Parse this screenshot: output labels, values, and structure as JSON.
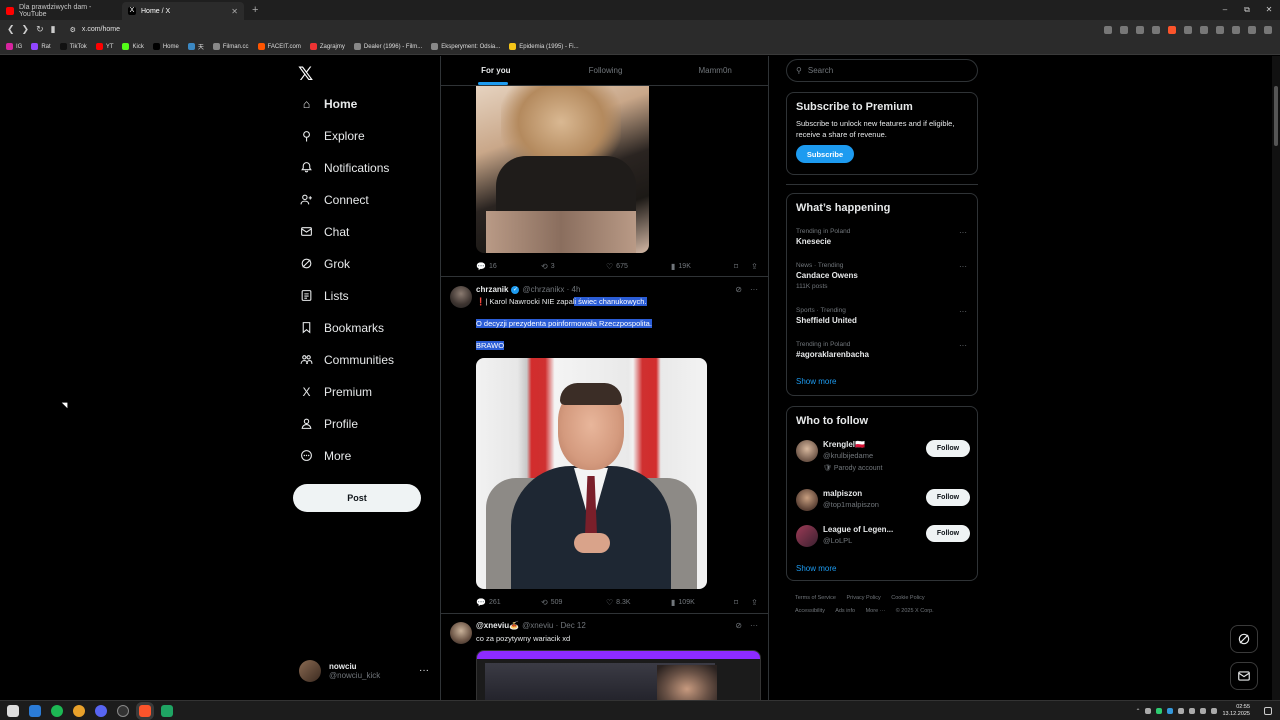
{
  "browser": {
    "tabs": [
      {
        "title": "Dla prawdziwych dam - YouTube",
        "favicon": "youtube-icon",
        "active": false
      },
      {
        "title": "Home / X",
        "favicon": "x-logo-icon",
        "active": true
      }
    ],
    "new_tab": "+",
    "window_controls": [
      "–",
      "⧉",
      "✕"
    ],
    "url": "x.com/home",
    "bookmarks": [
      "IG",
      "Rat",
      "TikTok",
      "YT",
      "Kick",
      "Home",
      "天",
      "Filman.cc",
      "FACEIT.com",
      "Zagrajmy",
      "Dealer (1996) - Film...",
      "Eksperyment: Odsia...",
      "Epidemia (1995) - Fi..."
    ]
  },
  "sidebar": {
    "items": [
      {
        "label": "Home",
        "icon": "home-icon",
        "glyph": "⌂"
      },
      {
        "label": "Explore",
        "icon": "search-icon",
        "glyph": "⚲"
      },
      {
        "label": "Notifications",
        "icon": "bell-icon",
        "glyph": "🔔"
      },
      {
        "label": "Connect",
        "icon": "add-person-icon",
        "glyph": "⚇"
      },
      {
        "label": "Chat",
        "icon": "mail-icon",
        "glyph": "✉"
      },
      {
        "label": "Grok",
        "icon": "grok-icon",
        "glyph": "⊘"
      },
      {
        "label": "Lists",
        "icon": "lists-icon",
        "glyph": "☰"
      },
      {
        "label": "Bookmarks",
        "icon": "bookmark-icon",
        "glyph": "⌑"
      },
      {
        "label": "Communities",
        "icon": "communities-icon",
        "glyph": "⚉"
      },
      {
        "label": "Premium",
        "icon": "x-logo-icon",
        "glyph": "X"
      },
      {
        "label": "Profile",
        "icon": "profile-icon",
        "glyph": "♙"
      },
      {
        "label": "More",
        "icon": "more-circle-icon",
        "glyph": "⋯"
      }
    ],
    "post_label": "Post",
    "account": {
      "name": "nowciu",
      "handle": "@nowciu_kick",
      "more": "···"
    }
  },
  "feed": {
    "tabs": [
      "For you",
      "Following",
      "Mamm0n"
    ],
    "tweet1": {
      "replies": "16",
      "reposts": "3",
      "likes": "675",
      "views": "19K"
    },
    "tweet2": {
      "name": "chrzanik",
      "handle": "@chrzanikx · 4h",
      "line1_plain": "❗| Karol Nawrocki NIE zapal",
      "line1_hl": "i świec chanukowych.",
      "line2": "O decyzji prezydenta poinformowała Rzeczpospolita.",
      "line3": "BRAWO",
      "replies": "261",
      "reposts": "509",
      "likes": "8.3K",
      "views": "109K"
    },
    "tweet3": {
      "name": "@xneviu🍝",
      "handle": "@xneviu · Dec 12",
      "text": "co za pozytywny wariacik xd"
    }
  },
  "right": {
    "search_placeholder": "Search",
    "premium": {
      "title": "Subscribe to Premium",
      "text": "Subscribe to unlock new features and if eligible, receive a share of revenue.",
      "button": "Subscribe"
    },
    "happening": {
      "title": "What’s happening",
      "trends": [
        {
          "category": "Trending in Poland",
          "title": "Knesecie",
          "count": ""
        },
        {
          "category": "News · Trending",
          "title": "Candace Owens",
          "count": "111K posts"
        },
        {
          "category": "Sports · Trending",
          "title": "Sheffield United",
          "count": ""
        },
        {
          "category": "Trending in Poland",
          "title": "#agoraklarenbacha",
          "count": ""
        }
      ],
      "show_more": "Show more"
    },
    "who_to_follow": {
      "title": "Who to follow",
      "accounts": [
        {
          "name": "Krenglel🇵🇱",
          "handle": "@krulbijedame",
          "note": "🛡 Parody account",
          "follow": "Follow"
        },
        {
          "name": "malpiszon",
          "handle": "@top1malpiszon",
          "note": "",
          "follow": "Follow"
        },
        {
          "name": "League of Legen...",
          "handle": "@LoLPL",
          "note": "",
          "follow": "Follow"
        }
      ],
      "show_more": "Show more"
    },
    "footer": [
      "Terms of Service",
      "Privacy Policy",
      "Cookie Policy",
      "Accessibility",
      "Ads info",
      "More ···",
      "© 2025 X Corp."
    ]
  },
  "taskbar": {
    "time": "02:55",
    "date": "13.12.2025"
  },
  "colors": {
    "accent": "#1d9bf0",
    "background": "#000000",
    "border": "#2f3336",
    "muted": "#71767b"
  }
}
